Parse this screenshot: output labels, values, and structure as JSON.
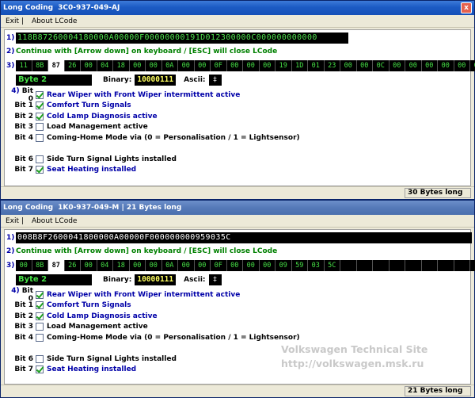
{
  "windows": [
    {
      "title": "Long Coding",
      "title_detail": "3C0-937-049-AJ",
      "close_label": "x",
      "menu": [
        "Exit |",
        "About LCode"
      ],
      "row1_num": "1)",
      "coding_string": "118B87260004180000A00000F00000000191D012300000C000000000000",
      "row2_num": "2)",
      "instruction": "Continue with [Arrow down] on keyboard / [ESC] will close LCode",
      "row3_num": "3)",
      "bytes": [
        "11",
        "8B",
        "87",
        "26",
        "00",
        "04",
        "18",
        "00",
        "00",
        "0A",
        "00",
        "00",
        "0F",
        "00",
        "00",
        "00",
        "19",
        "1D",
        "01",
        "23",
        "00",
        "00",
        "0C",
        "00",
        "00",
        "00",
        "00",
        "00",
        "00"
      ],
      "selected_byte_index": 2,
      "empty_cells": 0,
      "byte_label": "Byte 2",
      "binary_label": "Binary:",
      "binary_value": "10000111",
      "ascii_label": "Ascii:",
      "ascii_value": "‡",
      "row4_num": "4)",
      "bits": [
        {
          "label": "Bit 0",
          "text": "Rear Wiper with Front Wiper intermittent active",
          "checked": true
        },
        {
          "label": "Bit 1",
          "text": "Comfort Turn Signals",
          "checked": true
        },
        {
          "label": "Bit 2",
          "text": "Cold Lamp Diagnosis active",
          "checked": true
        },
        {
          "label": "Bit 3",
          "text": "Load Management active",
          "checked": false
        },
        {
          "label": "Bit 4",
          "text": "Coming-Home Mode via (0 = Personalisation / 1 = Lightsensor)",
          "checked": false
        },
        {
          "label": "",
          "text": "",
          "checked": false,
          "blank": true
        },
        {
          "label": "Bit 6",
          "text": "Side Turn Signal Lights installed",
          "checked": false
        },
        {
          "label": "Bit 7",
          "text": "Seat Heating installed",
          "checked": true
        }
      ],
      "status": "30 Bytes long"
    },
    {
      "title": "Long Coding",
      "title_detail": "1K0-937-049-M | 21 Bytes long",
      "close_label": "",
      "menu": [
        "Exit |",
        "About LCode"
      ],
      "row1_num": "1)",
      "coding_string": "008B8F2600041800000A00000F000000000959035C",
      "row2_num": "2)",
      "instruction": "Continue with [Arrow down] on keyboard / [ESC] will close LCode",
      "row3_num": "3)",
      "bytes": [
        "00",
        "8B",
        "87",
        "26",
        "00",
        "04",
        "18",
        "00",
        "00",
        "0A",
        "00",
        "00",
        "0F",
        "00",
        "00",
        "00",
        "09",
        "59",
        "03",
        "5C"
      ],
      "selected_byte_index": 2,
      "empty_cells": 9,
      "byte_label": "Byte 2",
      "binary_label": "Binary:",
      "binary_value": "10000111",
      "ascii_label": "Ascii:",
      "ascii_value": "‡",
      "row4_num": "4)",
      "bits": [
        {
          "label": "Bit 0",
          "text": "Rear Wiper with Front Wiper intermittent active",
          "checked": true
        },
        {
          "label": "Bit 1",
          "text": "Comfort Turn Signals",
          "checked": true
        },
        {
          "label": "Bit 2",
          "text": "Cold Lamp Diagnosis active",
          "checked": true
        },
        {
          "label": "Bit 3",
          "text": "Load Management active",
          "checked": false
        },
        {
          "label": "Bit 4",
          "text": "Coming-Home Mode via (0 = Personalisation / 1 = Lightsensor)",
          "checked": false
        },
        {
          "label": "",
          "text": "",
          "checked": false,
          "blank": true
        },
        {
          "label": "Bit 6",
          "text": "Side Turn Signal Lights installed",
          "checked": false
        },
        {
          "label": "Bit 7",
          "text": "Seat Heating installed",
          "checked": true
        }
      ],
      "status": "21 Bytes long"
    }
  ],
  "watermark": {
    "line1": "Volkswagen Technical Site",
    "line2": "http://volkswagen.msk.ru"
  }
}
